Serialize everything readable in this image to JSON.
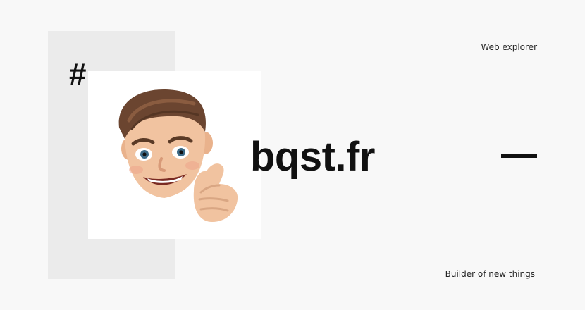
{
  "brand": {
    "symbol": "#",
    "site_name": "bqst.fr",
    "tagline_top": "Web explorer",
    "tagline_bottom": "Builder of new things"
  },
  "avatar": {
    "icon": "memoji-thumbs-up-avatar",
    "description_visible": false
  },
  "colors": {
    "background": "#f8f8f8",
    "block": "#ebebeb",
    "card": "#ffffff",
    "text": "#111111"
  }
}
